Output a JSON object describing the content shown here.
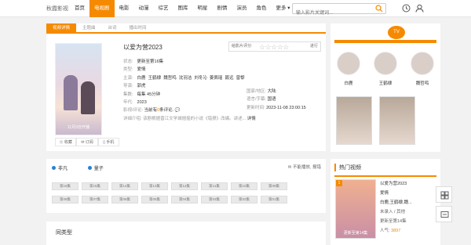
{
  "nav": {
    "logo": "秋霞影视",
    "items": [
      "首页",
      "电视剧",
      "电影",
      "动漫",
      "综艺",
      "图库",
      "明星",
      "剧情",
      "演员",
      "角色"
    ],
    "more": "更多 ▾"
  },
  "search": {
    "placeholder": "输入影片关键词..."
  },
  "tabs": [
    "视频详情",
    "主题曲",
    "台词",
    "播出时间"
  ],
  "movie": {
    "title": "以爱为营2023",
    "rating_label": "给影片评分:",
    "rating_go": "进行",
    "poster_text": "11月3日开播",
    "status_l": "状态:",
    "status_v": "更新至第16集",
    "type_l": "类型:",
    "type_v": "爱情",
    "cast_l": "主演:",
    "cast": [
      "白鹿",
      "王鹤棣",
      "魏哲鸣",
      "沈羽洁",
      "刘冬沁",
      "姜佩瑶",
      "聂远",
      "曾黎"
    ],
    "director_l": "导演:",
    "director_v": "郭虎",
    "duration_l": "集数:",
    "duration_v": "每集 45分钟",
    "year_l": "年代:",
    "year_v": "2023",
    "region_l": "国家/地区:",
    "region_v": "大陆",
    "lang_l": "语言/字幕:",
    "lang_v": "国语",
    "update_l": "更新时间:",
    "update_v": "2023-11-08 23:00:15",
    "review_l": "影视/评论:",
    "review_a": "当前有",
    "review_n": "0",
    "review_b": "条评论.",
    "intro_l": "详细介绍:",
    "intro_v": "该剧根据晋江文学城翘摇的小说《错撩》改编。讲述...",
    "intro_more": "详情"
  },
  "actions": [
    "收藏",
    "订阅",
    "手机"
  ],
  "castpanel": {
    "names": [
      "白鹿",
      "王鹤棣",
      "魏哲鸣"
    ]
  },
  "episodes": {
    "sources": [
      "非凡",
      "量子"
    ],
    "report": "不能播放, 报错",
    "row1": [
      "第16集",
      "第15集",
      "第14集",
      "第13集",
      "第12集",
      "第11集",
      "第10集",
      "第09集"
    ],
    "row2": [
      "第08集",
      "第07集",
      "第06集",
      "第05集",
      "第04集",
      "第03集",
      "第02集",
      "第01集"
    ]
  },
  "similar": {
    "title": "同类型"
  },
  "hot": {
    "title": "热门视频",
    "rank": "1",
    "poster_cap": "更新至第14集",
    "name": "以爱为营2023",
    "genre": "爱情",
    "cast": "白鹿,王鹤棣,魏...",
    "region": "未录入 / 其他",
    "status": "更新至第14集",
    "pop_l": "人气:",
    "pop_v": "3897"
  },
  "colors": {
    "accent": "#f58a00",
    "link": "#2a7fd4"
  }
}
